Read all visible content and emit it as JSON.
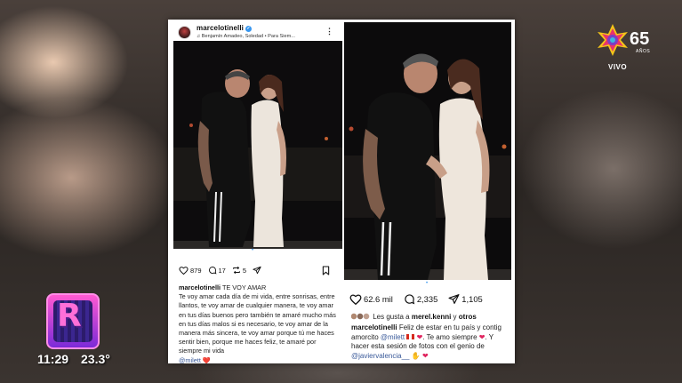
{
  "broadcast": {
    "channel_number": "65",
    "channel_sub": "AÑOS",
    "live_label": "VIVO",
    "time": "11:29",
    "temperature": "23.3°"
  },
  "left_post": {
    "username": "marcelotinelli",
    "music": "Benjamín Amadeo, Soledad • Para Siem...",
    "likes": "879",
    "comments": "17",
    "shares": "5",
    "caption_user": "marcelotinelli",
    "caption_title": "TE VOY AMAR",
    "caption_body": "Te voy amar cada día de mi vida, entre sonrisas, entre llantos, te voy amar de cualquier manera, te voy amar en tus días buenos pero también te amaré mucho más en tus días malos si es necesario, te voy amar de la manera más sincera, te voy amar porque tú me haces sentir bien, porque me haces feliz, te amaré por siempre mi vida",
    "caption_mention": "@milett",
    "caption_emoji": "❤️"
  },
  "right_post": {
    "likes": "62.6 mil",
    "comments": "2,335",
    "shares": "1,105",
    "liked_by_prefix": "Les gusta a",
    "liked_by_user": "merel.kenni",
    "liked_by_suffix": "y",
    "liked_by_others": "otros",
    "caption_user": "marcelotinelli",
    "caption_text_1": "Feliz de estar en tu país y contig amorcito",
    "caption_mention_1": "@milett",
    "caption_text_2": ". Te amo siempre",
    "caption_text_3": ". Y hacer esta sesión de fotos con el genio de",
    "caption_mention_2": "@javiervalencia__"
  },
  "colors": {
    "accent_blue": "#3897f0",
    "heart_red": "#e0245e",
    "badge_pink": "#ff5ad2"
  }
}
